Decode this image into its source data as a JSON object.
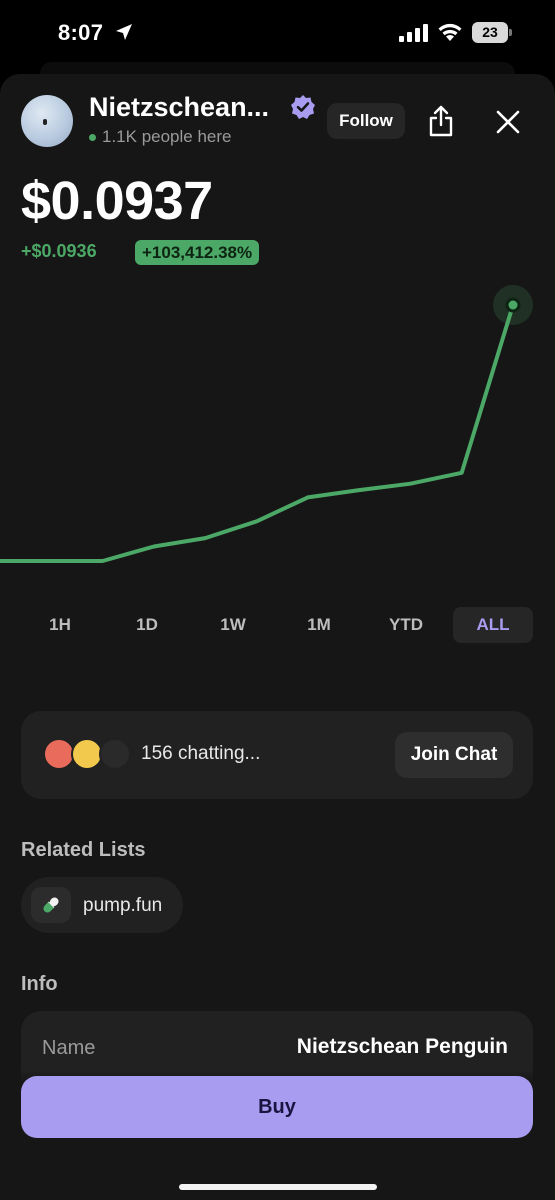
{
  "status_bar": {
    "time": "8:07",
    "battery": "23"
  },
  "token": {
    "name": "Nietzschean...",
    "presence": "1.1K people here",
    "follow_label": "Follow",
    "price": "$0.0937",
    "change_abs": "+$0.0936",
    "change_pct": "+103,412.38%"
  },
  "chart_data": {
    "type": "line",
    "x": [
      0,
      1,
      2,
      3,
      4,
      5,
      6,
      7,
      8,
      9,
      10
    ],
    "series": [
      {
        "values": [
          0.0001,
          0.0001,
          0.0001,
          0.0002,
          0.0004,
          0.0012,
          0.0035,
          0.0045,
          0.0055,
          0.0075,
          0.0937
        ]
      }
    ],
    "color": "#4ca866"
  },
  "ranges": [
    "1H",
    "1D",
    "1W",
    "1M",
    "YTD",
    "ALL"
  ],
  "active_range": "ALL",
  "chat": {
    "text": "156 chatting...",
    "join_label": "Join Chat"
  },
  "related": {
    "title": "Related Lists",
    "items": [
      {
        "label": "pump.fun",
        "icon": "pill-icon"
      }
    ]
  },
  "info": {
    "title": "Info",
    "rows": [
      {
        "label": "Name",
        "value": "Nietzschean Penguin"
      }
    ]
  },
  "buy_label": "Buy",
  "colors": {
    "accent": "#a89cf0",
    "positive": "#4ca866",
    "background": "#161616",
    "card": "#212121"
  }
}
